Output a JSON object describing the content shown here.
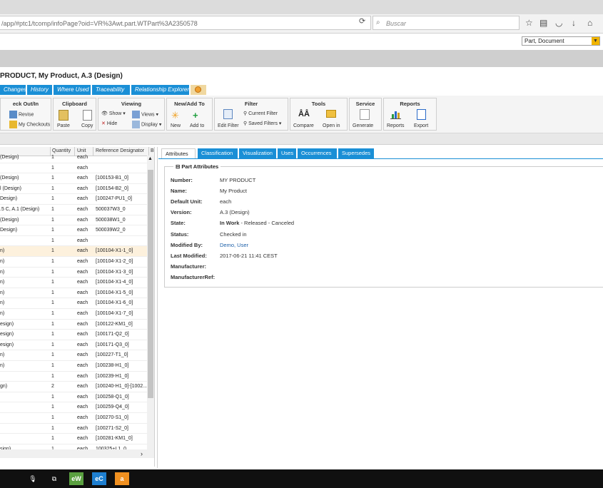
{
  "browser": {
    "url": "/app/#ptc1/tcomp/infoPage?oid=VR%3Awt.part.WTPart%3A2350578",
    "search_placeholder": "Buscar"
  },
  "app": {
    "type_select": "Part, Document",
    "title": "PRODUCT, My Product, A.3 (Design)"
  },
  "tabs": [
    "Changes",
    "History",
    "Where Used",
    "Traceability",
    "Relationship Explorer"
  ],
  "toolbar": {
    "groups": {
      "checkout": "eck Out/In",
      "clipboard": "Clipboard",
      "viewing": "Viewing",
      "newadd": "New/Add To",
      "filter": "Filter",
      "tools": "Tools",
      "service": "Service",
      "reports": "Reports"
    },
    "buttons": {
      "revise": "Revise",
      "my_checkouts": "My Checkouts",
      "paste": "Paste",
      "copy": "Copy",
      "show": "Show",
      "views": "Views",
      "hide": "Hide",
      "display": "Display",
      "new": "New",
      "add_to": "Add to",
      "edit_filter": "Edit Filter",
      "current_filter": "Current Filter",
      "saved_filters": "Saved Filters",
      "compare": "Compare",
      "open_in": "Open in",
      "generate": "Generate",
      "reports": "Reports",
      "export": "Export"
    }
  },
  "grid": {
    "headers": [
      "Quantity",
      "Unit",
      "Reference Designator",
      "B"
    ],
    "rows": [
      {
        "name": "(Design)",
        "qty": "1",
        "unit": "each",
        "ref": ""
      },
      {
        "name": "",
        "qty": "1",
        "unit": "each",
        "ref": ""
      },
      {
        "name": "(Design)",
        "qty": "1",
        "unit": "each",
        "ref": "[100153-B1_0]"
      },
      {
        "name": "l (Design)",
        "qty": "1",
        "unit": "each",
        "ref": "[100154-B2_0]"
      },
      {
        "name": "Design)",
        "qty": "1",
        "unit": "each",
        "ref": "[100247-PU1_0]"
      },
      {
        "name": ".5 C, A.1 (Design)",
        "qty": "1",
        "unit": "each",
        "ref": "500037W3_0"
      },
      {
        "name": "(Design)",
        "qty": "1",
        "unit": "each",
        "ref": "500038W1_0"
      },
      {
        "name": "Design)",
        "qty": "1",
        "unit": "each",
        "ref": "500039W2_0"
      },
      {
        "name": "",
        "qty": "1",
        "unit": "each",
        "ref": ""
      },
      {
        "name": "n)",
        "qty": "1",
        "unit": "each",
        "ref": "[100104-X1-1_0]"
      },
      {
        "name": "n)",
        "qty": "1",
        "unit": "each",
        "ref": "[100104-X1-2_0]"
      },
      {
        "name": "n)",
        "qty": "1",
        "unit": "each",
        "ref": "[100104-X1-3_0]"
      },
      {
        "name": "n)",
        "qty": "1",
        "unit": "each",
        "ref": "[100104-X1-4_0]"
      },
      {
        "name": "n)",
        "qty": "1",
        "unit": "each",
        "ref": "[100104-X1-5_0]"
      },
      {
        "name": "n)",
        "qty": "1",
        "unit": "each",
        "ref": "[100104-X1-6_0]"
      },
      {
        "name": "n)",
        "qty": "1",
        "unit": "each",
        "ref": "[100104-X1-7_0]"
      },
      {
        "name": "esign)",
        "qty": "1",
        "unit": "each",
        "ref": "[100122-KM1_0]"
      },
      {
        "name": "esign)",
        "qty": "1",
        "unit": "each",
        "ref": "[100171-Q2_0]"
      },
      {
        "name": "esign)",
        "qty": "1",
        "unit": "each",
        "ref": "[100171-Q3_0]"
      },
      {
        "name": "n)",
        "qty": "1",
        "unit": "each",
        "ref": "[100227-T1_0]"
      },
      {
        "name": "n)",
        "qty": "1",
        "unit": "each",
        "ref": "[100238-H1_0]"
      },
      {
        "name": "",
        "qty": "1",
        "unit": "each",
        "ref": "[100239-H1_0]"
      },
      {
        "name": "gn)",
        "qty": "2",
        "unit": "each",
        "ref": "[100240-H1_0]-[1002..."
      },
      {
        "name": "",
        "qty": "1",
        "unit": "each",
        "ref": "[100258-Q1_0]"
      },
      {
        "name": "",
        "qty": "1",
        "unit": "each",
        "ref": "[100259-Q4_0]"
      },
      {
        "name": "",
        "qty": "1",
        "unit": "each",
        "ref": "[100270-S1_0]"
      },
      {
        "name": "",
        "qty": "1",
        "unit": "each",
        "ref": "[100271-S2_0]"
      },
      {
        "name": "",
        "qty": "1",
        "unit": "each",
        "ref": "[100281-KM1_0]"
      },
      {
        "name": "sign)",
        "qty": "1",
        "unit": "each",
        "ref": "100325+L1_0"
      }
    ]
  },
  "detail_tabs": [
    "Attributes",
    "Classification",
    "Visualization",
    "Uses",
    "Occurrences",
    "Supersedes"
  ],
  "attributes": {
    "section_title": "Part Attributes",
    "labels": {
      "number": "Number:",
      "name": "Name:",
      "default_unit": "Default Unit:",
      "version": "Version:",
      "state": "State:",
      "status": "Status:",
      "modified_by": "Modified By:",
      "last_modified": "Last Modified:",
      "manufacturer": "Manufacturer:",
      "manufacturer_ref": "ManufacturerRef:"
    },
    "values": {
      "number": "MY PRODUCT",
      "name": "My Product",
      "default_unit": "each",
      "version": "A.3 (Design)",
      "state_current": "In Work",
      "state_rest": " - Released - Canceled",
      "status": "Checked in",
      "modified_by": "Demo, User",
      "last_modified": "2017-06-21 11:41 CEST"
    }
  },
  "taskbar": {
    "ew": "eW",
    "ec": "eC",
    "a": "a"
  },
  "colors": {
    "tab_blue": "#1a8fd6",
    "selected_row": "#fdf1dd"
  }
}
